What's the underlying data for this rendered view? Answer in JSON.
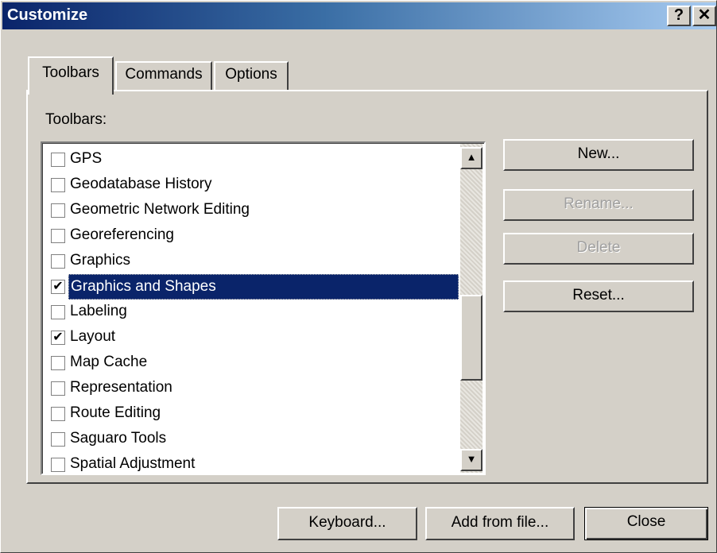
{
  "window": {
    "title": "Customize",
    "help_label": "?",
    "close_label": "✕"
  },
  "tabs": [
    {
      "label": "Toolbars",
      "active": true
    },
    {
      "label": "Commands",
      "active": false
    },
    {
      "label": "Options",
      "active": false
    }
  ],
  "toolbars_label": "Toolbars:",
  "toolbar_list": [
    {
      "label": "GPS",
      "checked": false,
      "selected": false
    },
    {
      "label": "Geodatabase History",
      "checked": false,
      "selected": false
    },
    {
      "label": "Geometric Network Editing",
      "checked": false,
      "selected": false
    },
    {
      "label": "Georeferencing",
      "checked": false,
      "selected": false
    },
    {
      "label": "Graphics",
      "checked": false,
      "selected": false
    },
    {
      "label": "Graphics and Shapes",
      "checked": true,
      "selected": true
    },
    {
      "label": "Labeling",
      "checked": false,
      "selected": false
    },
    {
      "label": "Layout",
      "checked": true,
      "selected": false
    },
    {
      "label": "Map Cache",
      "checked": false,
      "selected": false
    },
    {
      "label": "Representation",
      "checked": false,
      "selected": false
    },
    {
      "label": "Route Editing",
      "checked": false,
      "selected": false
    },
    {
      "label": "Saguaro Tools",
      "checked": false,
      "selected": false
    },
    {
      "label": "Spatial Adjustment",
      "checked": false,
      "selected": false
    }
  ],
  "side_buttons": {
    "new": "New...",
    "rename": "Rename...",
    "delete": "Delete",
    "reset": "Reset..."
  },
  "bottom_buttons": {
    "keyboard": "Keyboard...",
    "add_from_file": "Add from file...",
    "close": "Close"
  },
  "scrollbar": {
    "up_arrow": "▲",
    "down_arrow": "▼"
  }
}
